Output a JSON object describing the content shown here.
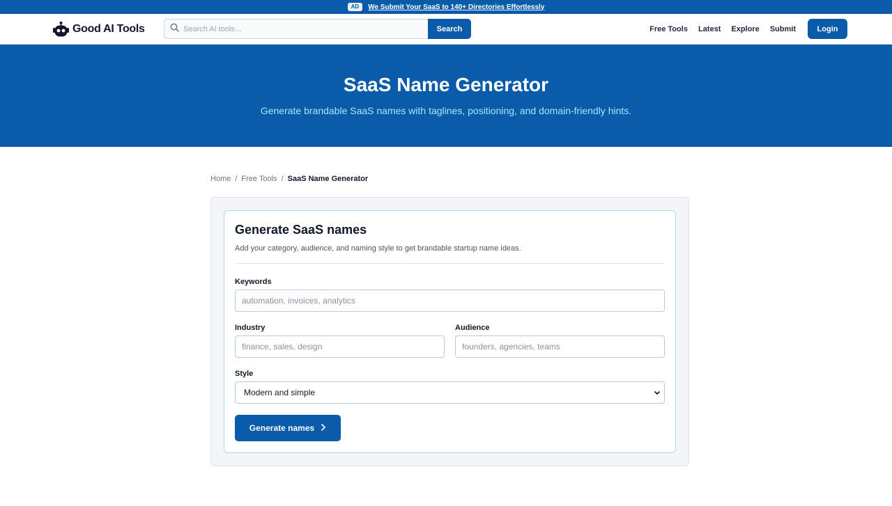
{
  "topbar": {
    "ad_badge": "AD",
    "promo_text": "We Submit Your SaaS to 140+ Directories Effortlessly"
  },
  "header": {
    "logo_text": "Good AI Tools",
    "search": {
      "placeholder": "Search AI tools...",
      "value": "",
      "button_label": "Search"
    },
    "nav": [
      "Free Tools",
      "Latest",
      "Explore",
      "Submit"
    ],
    "login_label": "Login"
  },
  "hero": {
    "title": "SaaS Name Generator",
    "subtitle": "Generate brandable SaaS names with taglines, positioning, and domain-friendly hints."
  },
  "breadcrumb": {
    "items": [
      "Home",
      "Free Tools"
    ],
    "separator": "/",
    "current": "SaaS Name Generator"
  },
  "form": {
    "title": "Generate SaaS names",
    "description": "Add your category, audience, and naming style to get brandable startup name ideas.",
    "keywords": {
      "label": "Keywords",
      "placeholder": "automation, invoices, analytics",
      "value": ""
    },
    "industry": {
      "label": "Industry",
      "placeholder": "finance, sales, design",
      "value": ""
    },
    "audience": {
      "label": "Audience",
      "placeholder": "founders, agencies, teams",
      "value": ""
    },
    "style": {
      "label": "Style",
      "selected": "Modern and simple"
    },
    "submit_label": "Generate names"
  },
  "icons": {
    "logo": "robot-logo-icon",
    "search": "search-icon",
    "select": "chevron-down-icon",
    "submit": "chevron-right-icon"
  },
  "colors": {
    "brand": "#0a5cab",
    "hero_subtitle": "#a6e6f5",
    "card_border": "#a9dde9"
  }
}
